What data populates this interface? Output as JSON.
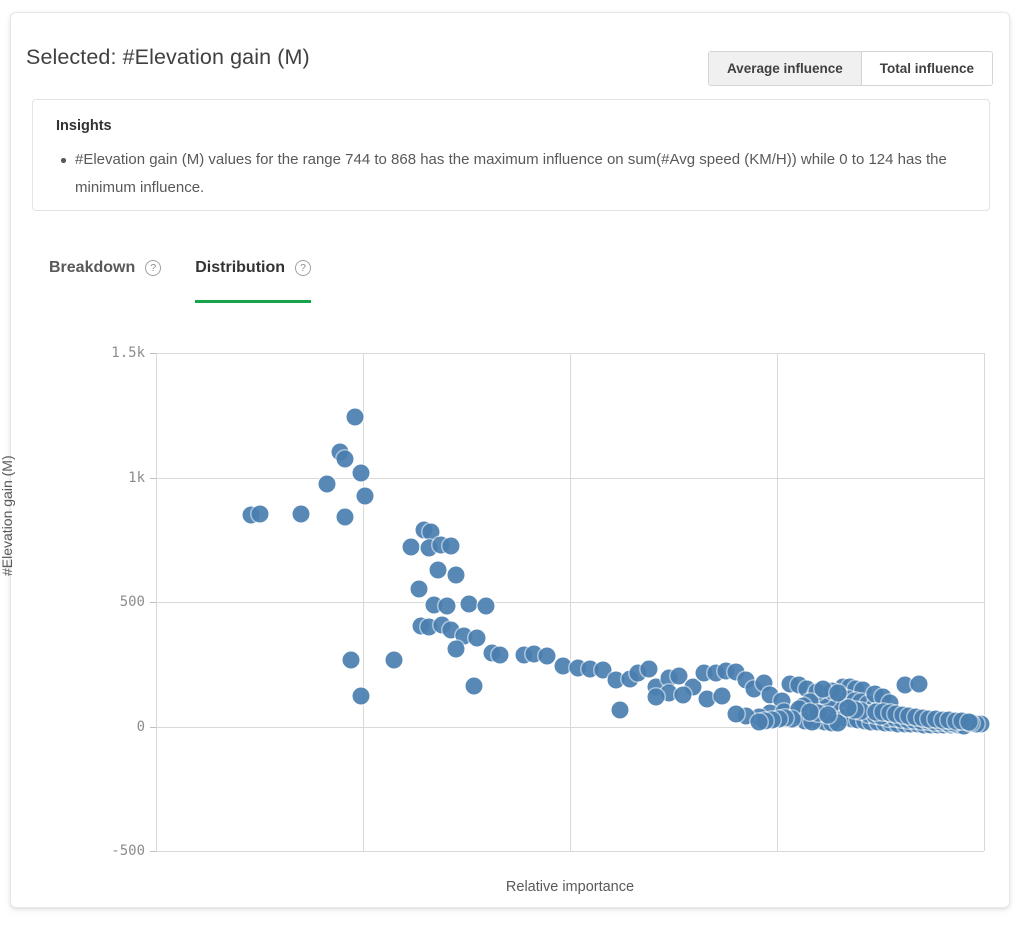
{
  "header": {
    "title": "Selected: #Elevation gain (M)",
    "toggle": {
      "average_label": "Average influence",
      "total_label": "Total influence",
      "active": "average"
    }
  },
  "insights": {
    "title": "Insights",
    "items": [
      "#Elevation gain (M) values for the range 744 to 868 has the maximum influence on sum(#Avg speed (KM/H)) while 0 to 124 has the minimum influence."
    ]
  },
  "tabs": [
    {
      "label": "Breakdown",
      "help": "?",
      "active": false
    },
    {
      "label": "Distribution",
      "help": "?",
      "active": true
    }
  ],
  "colors": {
    "accent_green": "#16a34a",
    "point_blue": "#4a7fb0",
    "grid": "#d9d9d9",
    "text": "#404040"
  },
  "chart_data": {
    "type": "scatter",
    "title": "",
    "xlabel": "Relative importance",
    "ylabel": "#Elevation gain (M)",
    "ylim": [
      -500,
      1500
    ],
    "yticks": [
      1500,
      1000,
      500,
      0,
      -500
    ],
    "ytick_labels": [
      "1.5k",
      "1k",
      "500",
      "0",
      "-500"
    ],
    "xlim": [
      0,
      1
    ],
    "xticks": [
      0,
      0.25,
      0.5,
      0.75,
      1.0
    ],
    "xtick_labels": [
      "",
      "",
      "",
      "",
      ""
    ],
    "grid": true,
    "legend": false,
    "series": [
      {
        "name": "#Elevation gain (M)",
        "color": "#4a7fb0",
        "points": [
          [
            0.115,
            850
          ],
          [
            0.125,
            855
          ],
          [
            0.175,
            853
          ],
          [
            0.24,
            1243
          ],
          [
            0.222,
            1103
          ],
          [
            0.228,
            1075
          ],
          [
            0.248,
            1020
          ],
          [
            0.206,
            973
          ],
          [
            0.252,
            925
          ],
          [
            0.228,
            843
          ],
          [
            0.324,
            789
          ],
          [
            0.332,
            782
          ],
          [
            0.308,
            722
          ],
          [
            0.33,
            716
          ],
          [
            0.344,
            728
          ],
          [
            0.356,
            723
          ],
          [
            0.34,
            627
          ],
          [
            0.362,
            610
          ],
          [
            0.318,
            552
          ],
          [
            0.336,
            487
          ],
          [
            0.352,
            482
          ],
          [
            0.378,
            490
          ],
          [
            0.398,
            483
          ],
          [
            0.32,
            404
          ],
          [
            0.33,
            398
          ],
          [
            0.346,
            408
          ],
          [
            0.356,
            386
          ],
          [
            0.372,
            364
          ],
          [
            0.388,
            355
          ],
          [
            0.362,
            310
          ],
          [
            0.406,
            294
          ],
          [
            0.416,
            288
          ],
          [
            0.444,
            286
          ],
          [
            0.456,
            290
          ],
          [
            0.472,
            283
          ],
          [
            0.236,
            268
          ],
          [
            0.288,
            266
          ],
          [
            0.248,
            122
          ],
          [
            0.384,
            163
          ],
          [
            0.492,
            243
          ],
          [
            0.51,
            235
          ],
          [
            0.524,
            229
          ],
          [
            0.54,
            226
          ],
          [
            0.556,
            186
          ],
          [
            0.572,
            191
          ],
          [
            0.582,
            216
          ],
          [
            0.596,
            232
          ],
          [
            0.604,
            160
          ],
          [
            0.56,
            67
          ],
          [
            0.62,
            195
          ],
          [
            0.632,
            202
          ],
          [
            0.648,
            160
          ],
          [
            0.662,
            214
          ],
          [
            0.676,
            216
          ],
          [
            0.688,
            222
          ],
          [
            0.7,
            218
          ],
          [
            0.712,
            186
          ],
          [
            0.666,
            110
          ],
          [
            0.684,
            124
          ],
          [
            0.722,
            150
          ],
          [
            0.734,
            176
          ],
          [
            0.742,
            128
          ],
          [
            0.756,
            104
          ],
          [
            0.62,
            133
          ],
          [
            0.636,
            126
          ],
          [
            0.604,
            120
          ],
          [
            0.766,
            171
          ],
          [
            0.776,
            167
          ],
          [
            0.786,
            150
          ],
          [
            0.796,
            120
          ],
          [
            0.8,
            90
          ],
          [
            0.808,
            72
          ],
          [
            0.816,
            64
          ],
          [
            0.822,
            48
          ],
          [
            0.742,
            56
          ],
          [
            0.758,
            60
          ],
          [
            0.774,
            48
          ],
          [
            0.788,
            36
          ],
          [
            0.728,
            38
          ],
          [
            0.712,
            44
          ],
          [
            0.7,
            52
          ],
          [
            0.83,
            160
          ],
          [
            0.838,
            158
          ],
          [
            0.846,
            152
          ],
          [
            0.854,
            146
          ],
          [
            0.828,
            118
          ],
          [
            0.836,
            112
          ],
          [
            0.844,
            104
          ],
          [
            0.852,
            98
          ],
          [
            0.86,
            92
          ],
          [
            0.868,
            84
          ],
          [
            0.874,
            76
          ],
          [
            0.82,
            100
          ],
          [
            0.812,
            110
          ],
          [
            0.806,
            126
          ],
          [
            0.798,
            140
          ],
          [
            0.79,
            100
          ],
          [
            0.782,
            84
          ],
          [
            0.776,
            70
          ],
          [
            0.832,
            36
          ],
          [
            0.84,
            30
          ],
          [
            0.848,
            26
          ],
          [
            0.856,
            22
          ],
          [
            0.864,
            20
          ],
          [
            0.872,
            18
          ],
          [
            0.88,
            16
          ],
          [
            0.888,
            14
          ],
          [
            0.896,
            12
          ],
          [
            0.904,
            12
          ],
          [
            0.912,
            10
          ],
          [
            0.92,
            10
          ],
          [
            0.928,
            8
          ],
          [
            0.936,
            8
          ],
          [
            0.944,
            6
          ],
          [
            0.952,
            6
          ],
          [
            0.96,
            5
          ],
          [
            0.968,
            5
          ],
          [
            0.976,
            4
          ],
          [
            0.8,
            22
          ],
          [
            0.808,
            18
          ],
          [
            0.816,
            16
          ],
          [
            0.824,
            14
          ],
          [
            0.784,
            24
          ],
          [
            0.792,
            20
          ],
          [
            0.768,
            30
          ],
          [
            0.76,
            34
          ],
          [
            0.752,
            30
          ],
          [
            0.744,
            28
          ],
          [
            0.736,
            24
          ],
          [
            0.728,
            20
          ],
          [
            0.884,
            36
          ],
          [
            0.892,
            34
          ],
          [
            0.9,
            30
          ],
          [
            0.908,
            28
          ],
          [
            0.916,
            26
          ],
          [
            0.924,
            24
          ],
          [
            0.932,
            22
          ],
          [
            0.94,
            20
          ],
          [
            0.948,
            18
          ],
          [
            0.956,
            16
          ],
          [
            0.964,
            14
          ],
          [
            0.86,
            52
          ],
          [
            0.868,
            48
          ],
          [
            0.876,
            44
          ],
          [
            0.884,
            58
          ],
          [
            0.852,
            62
          ],
          [
            0.844,
            68
          ],
          [
            0.836,
            74
          ],
          [
            0.904,
            168
          ],
          [
            0.922,
            170
          ],
          [
            0.996,
            10
          ],
          [
            0.99,
            12
          ],
          [
            0.984,
            14
          ],
          [
            0.8,
            56
          ],
          [
            0.79,
            60
          ],
          [
            0.812,
            48
          ],
          [
            0.868,
            130
          ],
          [
            0.878,
            120
          ],
          [
            0.886,
            96
          ],
          [
            0.816,
            142
          ],
          [
            0.806,
            152
          ],
          [
            0.824,
            134
          ],
          [
            0.87,
            60
          ],
          [
            0.878,
            58
          ],
          [
            0.886,
            54
          ],
          [
            0.894,
            50
          ],
          [
            0.902,
            46
          ],
          [
            0.91,
            42
          ],
          [
            0.918,
            38
          ],
          [
            0.926,
            34
          ],
          [
            0.934,
            32
          ],
          [
            0.942,
            30
          ],
          [
            0.95,
            28
          ],
          [
            0.958,
            26
          ],
          [
            0.966,
            24
          ],
          [
            0.974,
            22
          ],
          [
            0.982,
            20
          ]
        ]
      }
    ]
  }
}
